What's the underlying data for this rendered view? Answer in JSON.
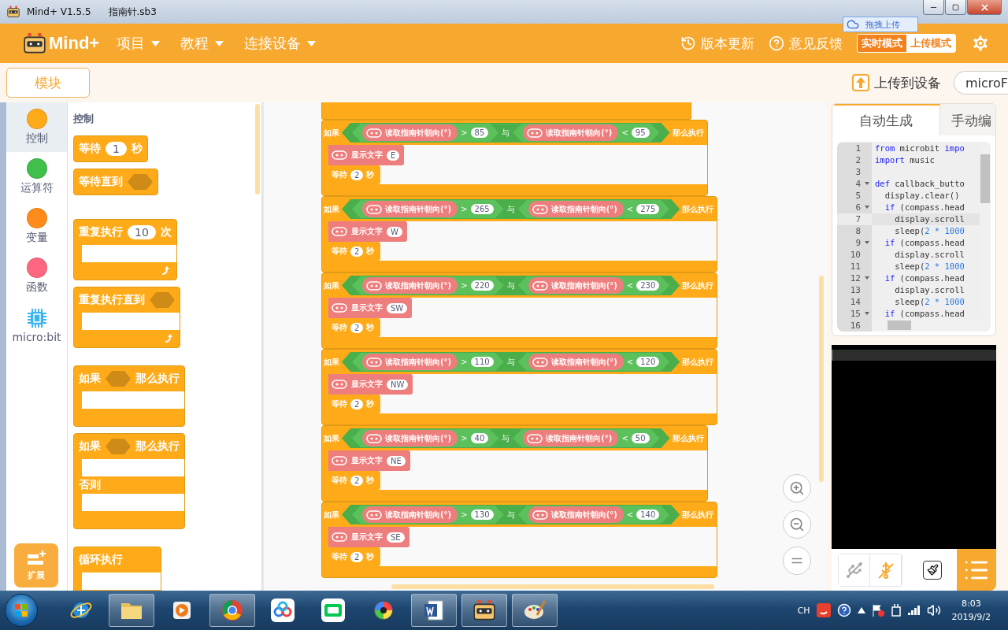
{
  "window": {
    "title": "Mind+ V1.5.5",
    "file": "指南针.sb3"
  },
  "header": {
    "logo": "Mind+",
    "menus": [
      {
        "label": "项目"
      },
      {
        "label": "教程"
      },
      {
        "label": "连接设备"
      }
    ],
    "links": [
      {
        "kind": "update",
        "label": "版本更新"
      },
      {
        "kind": "feedback",
        "label": "意见反馈"
      }
    ],
    "modes": [
      {
        "label": "实时模式",
        "selected": false
      },
      {
        "label": "上传模式",
        "selected": true
      }
    ],
    "drag_upload": "拖拽上传"
  },
  "toolbar": {
    "tab": "模块",
    "upload": "上传到设备",
    "device": "microF"
  },
  "categories": [
    {
      "kind": "dot",
      "label": "控制",
      "color": "#ffab19",
      "selected": true
    },
    {
      "kind": "dot",
      "label": "运算符",
      "color": "#40bf4a",
      "selected": false
    },
    {
      "kind": "dot",
      "label": "变量",
      "color": "#ff8c1a",
      "selected": false
    },
    {
      "kind": "dot",
      "label": "函数",
      "color": "#ff6680",
      "selected": false
    },
    {
      "kind": "chip",
      "label": "micro:bit",
      "selected": false
    }
  ],
  "extension": "扩展",
  "palette": {
    "title": "控制",
    "blocks": [
      {
        "kind": "command",
        "label": "等待",
        "input": "1",
        "suffix": "秒"
      },
      {
        "kind": "command",
        "label": "等待直到",
        "slot": true
      },
      {
        "kind": "loop",
        "label": "重复执行",
        "input": "10",
        "suffix": "次"
      },
      {
        "kind": "loop",
        "label": "重复执行直到",
        "slot": true
      },
      {
        "kind": "if",
        "label": "如果",
        "slot": true,
        "suffix": "那么执行"
      },
      {
        "kind": "ifelse",
        "label": "如果",
        "slot": true,
        "suffix": "那么执行",
        "else": "否则"
      },
      {
        "kind": "forever",
        "label": "循环执行"
      }
    ]
  },
  "scripts": [
    {
      "if": "如果",
      "left": {
        "reporter": "读取指南针朝向(°)",
        "op": ">",
        "value": "85"
      },
      "join": "与",
      "right": {
        "reporter": "读取指南针朝向(°)",
        "op": "<",
        "value": "95"
      },
      "then": "那么执行",
      "show": {
        "label": "显示文字",
        "text": "E"
      },
      "wait": {
        "label": "等待",
        "value": "2",
        "unit": "秒"
      }
    },
    {
      "if": "如果",
      "left": {
        "reporter": "读取指南针朝向(°)",
        "op": ">",
        "value": "265"
      },
      "join": "与",
      "right": {
        "reporter": "读取指南针朝向(°)",
        "op": "<",
        "value": "275"
      },
      "then": "那么执行",
      "show": {
        "label": "显示文字",
        "text": "W"
      },
      "wait": {
        "label": "等待",
        "value": "2",
        "unit": "秒"
      }
    },
    {
      "if": "如果",
      "left": {
        "reporter": "读取指南针朝向(°)",
        "op": ">",
        "value": "220"
      },
      "join": "与",
      "right": {
        "reporter": "读取指南针朝向(°)",
        "op": "<",
        "value": "230"
      },
      "then": "那么执行",
      "show": {
        "label": "显示文字",
        "text": "SW"
      },
      "wait": {
        "label": "等待",
        "value": "2",
        "unit": "秒"
      }
    },
    {
      "if": "如果",
      "left": {
        "reporter": "读取指南针朝向(°)",
        "op": ">",
        "value": "110"
      },
      "join": "与",
      "right": {
        "reporter": "读取指南针朝向(°)",
        "op": "<",
        "value": "120"
      },
      "then": "那么执行",
      "show": {
        "label": "显示文字",
        "text": "NW"
      },
      "wait": {
        "label": "等待",
        "value": "2",
        "unit": "秒"
      }
    },
    {
      "if": "如果",
      "left": {
        "reporter": "读取指南针朝向(°)",
        "op": ">",
        "value": "40"
      },
      "join": "与",
      "right": {
        "reporter": "读取指南针朝向(°)",
        "op": "<",
        "value": "50"
      },
      "then": "那么执行",
      "show": {
        "label": "显示文字",
        "text": "NE"
      },
      "wait": {
        "label": "等待",
        "value": "2",
        "unit": "秒"
      }
    },
    {
      "if": "如果",
      "left": {
        "reporter": "读取指南针朝向(°)",
        "op": ">",
        "value": "130"
      },
      "join": "与",
      "right": {
        "reporter": "读取指南针朝向(°)",
        "op": "<",
        "value": "140"
      },
      "then": "那么执行",
      "show": {
        "label": "显示文字",
        "text": "SE"
      },
      "wait": {
        "label": "等待",
        "value": "2",
        "unit": "秒"
      }
    }
  ],
  "code_panel": {
    "tabs": [
      {
        "label": "自动生成",
        "selected": true
      },
      {
        "label": "手动编",
        "selected": false
      }
    ],
    "lines": [
      {
        "no": "1",
        "fold": false,
        "active": false,
        "parts": [
          {
            "kind": "kw",
            "text": "from"
          },
          {
            "kind": "plain",
            "text": " microbit "
          },
          {
            "kind": "kw",
            "text": "impo"
          }
        ]
      },
      {
        "no": "2",
        "fold": false,
        "active": false,
        "parts": [
          {
            "kind": "kw",
            "text": "import"
          },
          {
            "kind": "plain",
            "text": " music"
          }
        ]
      },
      {
        "no": "3",
        "fold": false,
        "active": false
      },
      {
        "no": "4",
        "fold": true,
        "active": false,
        "parts": [
          {
            "kind": "kw",
            "text": "def"
          },
          {
            "kind": "plain",
            "text": " callback_butto"
          }
        ]
      },
      {
        "no": "5",
        "fold": false,
        "active": false,
        "parts": [
          {
            "kind": "plain",
            "text": "  display.clear()"
          }
        ]
      },
      {
        "no": "6",
        "fold": true,
        "active": false,
        "parts": [
          {
            "kind": "kw",
            "text": "  if"
          },
          {
            "kind": "plain",
            "text": " (compass.head"
          }
        ]
      },
      {
        "no": "7",
        "fold": false,
        "active": true,
        "parts": [
          {
            "kind": "plain",
            "text": "    display.scroll"
          }
        ]
      },
      {
        "no": "8",
        "fold": false,
        "active": false,
        "parts": [
          {
            "kind": "plain",
            "text": "    sleep("
          },
          {
            "kind": "num",
            "text": "2 * 1000"
          }
        ]
      },
      {
        "no": "9",
        "fold": true,
        "active": false,
        "parts": [
          {
            "kind": "kw",
            "text": "  if"
          },
          {
            "kind": "plain",
            "text": " (compass.head"
          }
        ]
      },
      {
        "no": "10",
        "fold": false,
        "active": false,
        "parts": [
          {
            "kind": "plain",
            "text": "    display.scroll"
          }
        ]
      },
      {
        "no": "11",
        "fold": false,
        "active": false,
        "parts": [
          {
            "kind": "plain",
            "text": "    sleep("
          },
          {
            "kind": "num",
            "text": "2 * 1000"
          }
        ]
      },
      {
        "no": "12",
        "fold": true,
        "active": false,
        "parts": [
          {
            "kind": "kw",
            "text": "  if"
          },
          {
            "kind": "plain",
            "text": " (compass.head"
          }
        ]
      },
      {
        "no": "13",
        "fold": false,
        "active": false,
        "parts": [
          {
            "kind": "plain",
            "text": "    display.scroll"
          }
        ]
      },
      {
        "no": "14",
        "fold": false,
        "active": false,
        "parts": [
          {
            "kind": "plain",
            "text": "    sleep("
          },
          {
            "kind": "num",
            "text": "2 * 1000"
          }
        ]
      },
      {
        "no": "15",
        "fold": true,
        "active": false,
        "parts": [
          {
            "kind": "kw",
            "text": "  if"
          },
          {
            "kind": "plain",
            "text": " (compass.head"
          }
        ]
      },
      {
        "no": "16",
        "fold": false,
        "active": false
      }
    ]
  },
  "taskbar": {
    "apps": [
      {
        "kind": "globe",
        "open": false
      },
      {
        "kind": "folder",
        "open": true
      },
      {
        "kind": "media",
        "open": false
      },
      {
        "kind": "wheel",
        "open": true
      },
      {
        "kind": "cloud",
        "open": false
      },
      {
        "kind": "tv",
        "open": false
      },
      {
        "kind": "rainbow",
        "open": false
      },
      {
        "kind": "document",
        "open": true
      },
      {
        "kind": "robot",
        "open": true
      },
      {
        "kind": "palette",
        "open": true
      }
    ],
    "tray": {
      "lang": "CH",
      "time": "8:03",
      "date": "2019/9/2"
    }
  }
}
